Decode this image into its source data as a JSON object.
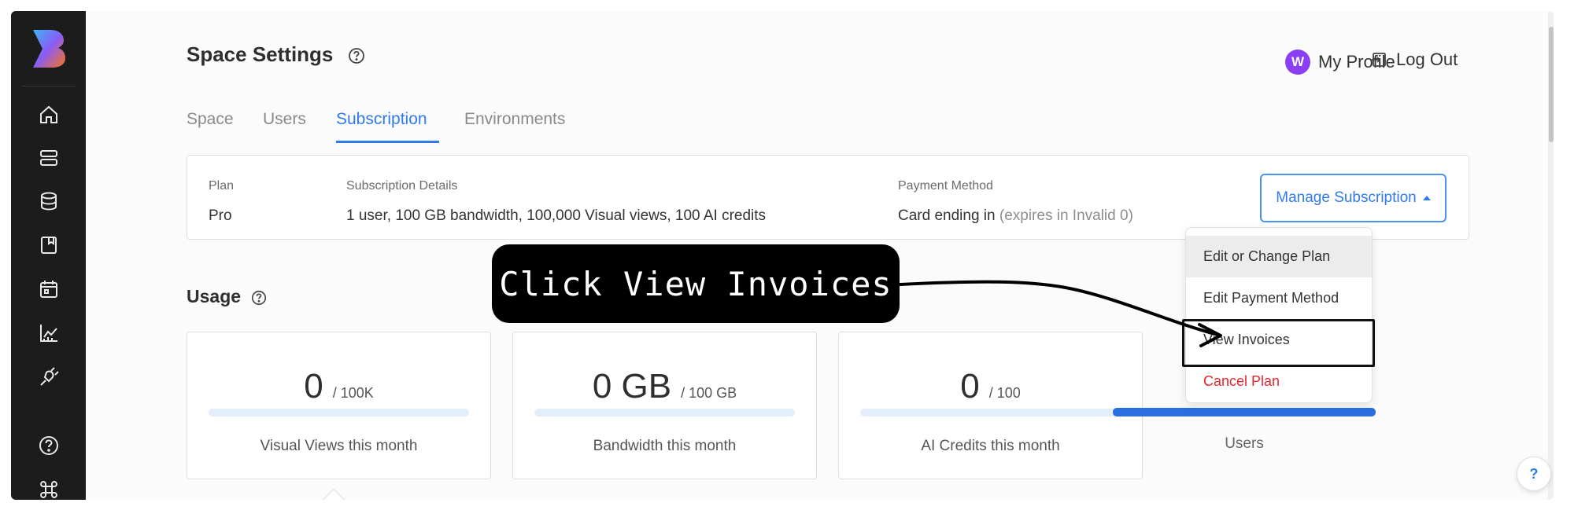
{
  "header": {
    "title": "Space Settings",
    "profile_initial": "W",
    "profile_label": "My Profile",
    "logout_label": "Log Out"
  },
  "tabs": [
    "Space",
    "Users",
    "Subscription",
    "Environments"
  ],
  "active_tab": "Subscription",
  "plan": {
    "plan_label": "Plan",
    "plan_value": "Pro",
    "details_label": "Subscription Details",
    "details_value": "1 user, 100 GB bandwidth, 100,000 Visual views, 100 AI credits",
    "payment_label": "Payment Method",
    "payment_value": "Card ending in",
    "payment_expiry": "(expires in Invalid 0)",
    "manage_button": "Manage Subscription"
  },
  "usage": {
    "title": "Usage",
    "cards": [
      {
        "value": "0",
        "limit": "/ 100K",
        "label": "Visual Views this month",
        "progress": 0
      },
      {
        "value": "0 GB",
        "limit": "/ 100 GB",
        "label": "Bandwidth this month",
        "progress": 0
      },
      {
        "value": "0",
        "limit": "/ 100",
        "label": "AI Credits this month",
        "progress": 0
      }
    ],
    "users_label": "Users"
  },
  "dropdown": {
    "items": [
      "Edit or Change Plan",
      "Edit Payment Method",
      "View Invoices",
      "Cancel Plan"
    ]
  },
  "annotation": {
    "text": "Click View Invoices"
  },
  "help_fab": "?",
  "colors": {
    "accent": "#2f7bea",
    "sidebar": "#1c1c1c",
    "danger": "#e8252f",
    "avatar": "#8b3ff3"
  },
  "icons": {
    "sidebar": [
      "home-icon",
      "layers-icon",
      "database-icon",
      "book-icon",
      "calendar-icon",
      "chart-icon",
      "plug-icon",
      "help-circle-icon",
      "command-icon"
    ]
  }
}
